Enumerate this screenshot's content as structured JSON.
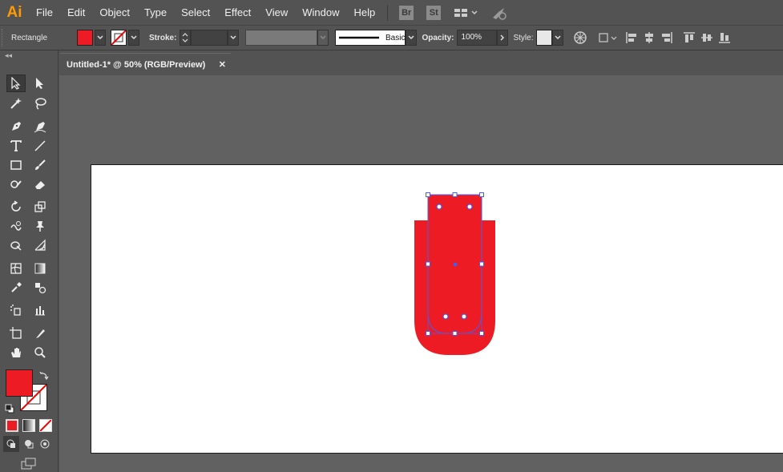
{
  "app": {
    "logo": "Ai"
  },
  "menu": [
    "File",
    "Edit",
    "Object",
    "Type",
    "Select",
    "Effect",
    "View",
    "Window",
    "Help"
  ],
  "bridge": {
    "br": "Br",
    "st": "St"
  },
  "control": {
    "tool_label": "Rectangle",
    "fill_color": "#ed1c24",
    "stroke_label": "Stroke:",
    "brush_label": "Basic",
    "opacity_label": "Opacity:",
    "opacity_value": "100%",
    "style_label": "Style:"
  },
  "document": {
    "tab_title": "Untitled-1* @ 50% (RGB/Preview)",
    "close": "✕"
  },
  "colors": {
    "fill": "#ed1c24",
    "selection": "#4b5ce6",
    "ui_bg": "#535353",
    "canvas_bg": "#616161"
  },
  "toolbar": {
    "collapse": "◂◂"
  }
}
